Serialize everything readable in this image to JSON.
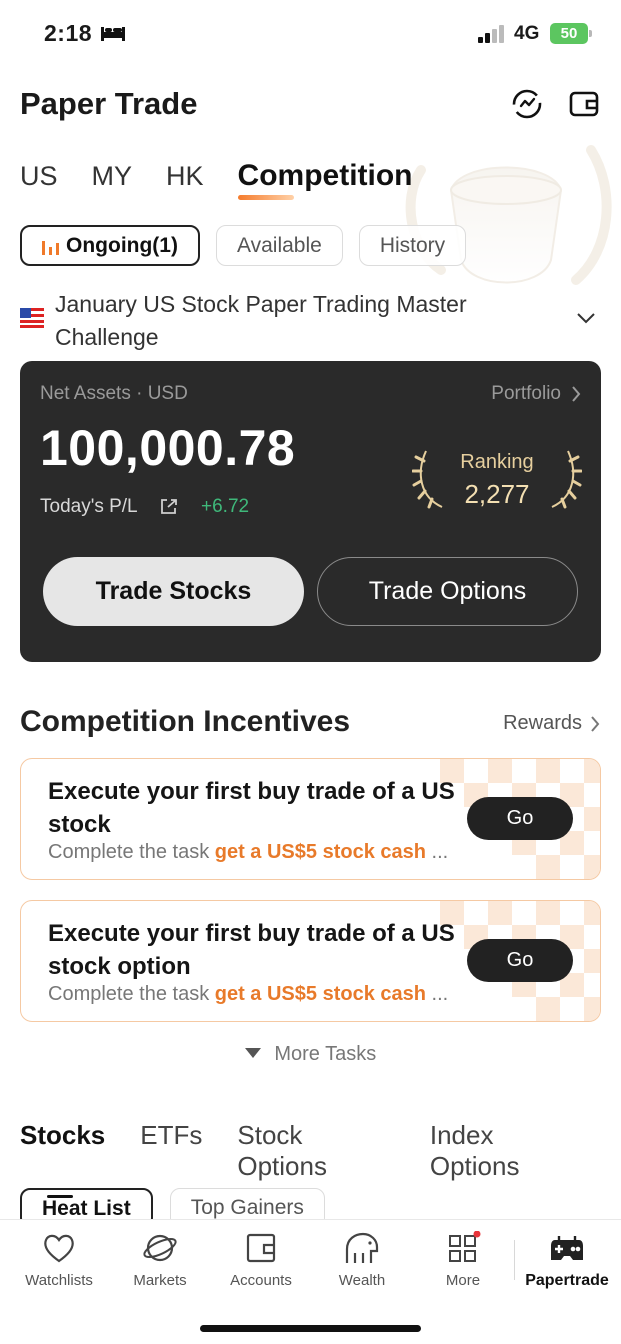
{
  "status_bar": {
    "time": "2:18",
    "network": "4G",
    "battery": "50"
  },
  "header": {
    "title": "Paper Trade",
    "icons": [
      "refresh-icon",
      "wallet-icon"
    ]
  },
  "market_tabs": [
    "US",
    "MY",
    "HK",
    "Competition"
  ],
  "filters": [
    {
      "label": "Ongoing(1)",
      "active": true
    },
    {
      "label": "Available",
      "active": false
    },
    {
      "label": "History",
      "active": false
    }
  ],
  "competition": {
    "name": "January US Stock Paper Trading Master Challenge",
    "flag": "us-flag-icon"
  },
  "account_card": {
    "net_assets_label": "Net Assets · USD",
    "portfolio_label": "Portfolio",
    "net_assets_value": "100,000.78",
    "todays_pl_label": "Today's P/L",
    "todays_pl_value": "+6.72",
    "ranking_label": "Ranking",
    "ranking_value": "2,277",
    "trade_stocks": "Trade Stocks",
    "trade_options": "Trade Options"
  },
  "incentives": {
    "title": "Competition Incentives",
    "rewards_label": "Rewards",
    "tasks": [
      {
        "title": "Execute your first buy trade of a US stock",
        "sub_prefix": "Complete the task ",
        "sub_highlight": "get a US$5 stock cash",
        "sub_suffix": " ...",
        "button": "Go"
      },
      {
        "title": "Execute your first buy trade of a US stock option",
        "sub_prefix": "Complete the task ",
        "sub_highlight": "get a US$5 stock cash",
        "sub_suffix": " ...",
        "button": "Go"
      }
    ],
    "more_tasks": "More Tasks"
  },
  "section_tabs": [
    "Stocks",
    "ETFs",
    "Stock Options",
    "Index Options"
  ],
  "sub_pills": [
    "Heat List",
    "Top Gainers"
  ],
  "tab_bar": [
    {
      "label": "Watchlists",
      "icon": "heart-icon"
    },
    {
      "label": "Markets",
      "icon": "planet-icon"
    },
    {
      "label": "Accounts",
      "icon": "wallet-icon"
    },
    {
      "label": "Wealth",
      "icon": "piggy-bank-icon"
    },
    {
      "label": "More",
      "icon": "grid-icon"
    },
    {
      "label": "Papertrade",
      "icon": "gamepad-icon"
    }
  ],
  "colors": {
    "accent": "#e87a2a",
    "gain": "#3fb87a",
    "card_bg": "#2a2a2a",
    "gold": "#e6cf9e"
  }
}
